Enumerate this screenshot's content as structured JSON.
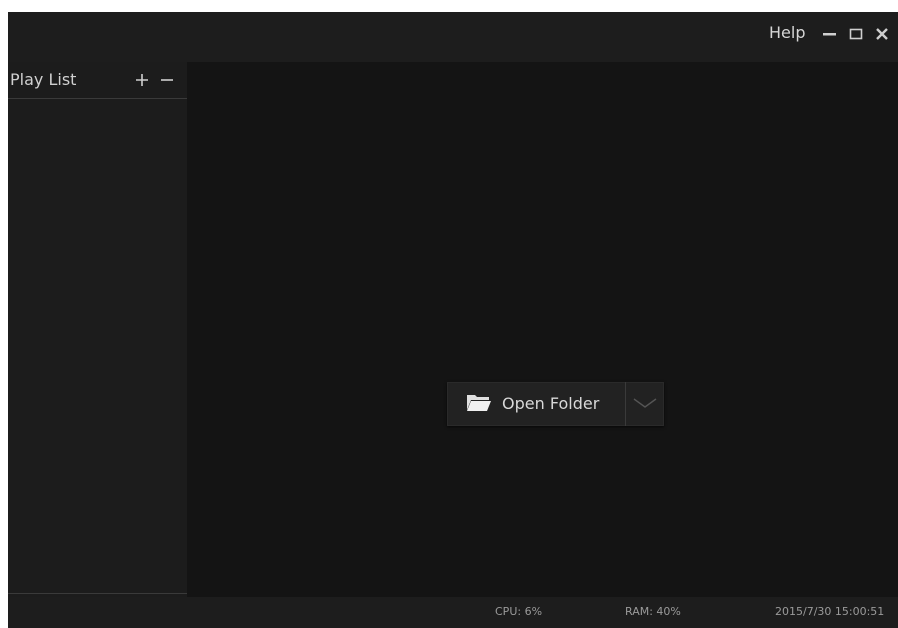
{
  "titlebar": {
    "help_label": "Help",
    "controls": [
      "minimize-icon",
      "maximize-icon",
      "close-icon"
    ]
  },
  "sidebar": {
    "title": "Play List",
    "add_icon": "plus-icon",
    "remove_icon": "minus-icon",
    "items": []
  },
  "main": {
    "open_folder": {
      "label": "Open Folder",
      "icon": "folder-icon",
      "dropdown_icon": "chevron-down-icon"
    }
  },
  "statusbar": {
    "cpu": "CPU: 6%",
    "ram": "RAM: 40%",
    "datetime": "2015/7/30 15:00:51"
  },
  "colors": {
    "background": "#141414",
    "panel": "#1c1c1c",
    "titlebar": "#1d1d1d",
    "text": "#d0d0d0"
  }
}
